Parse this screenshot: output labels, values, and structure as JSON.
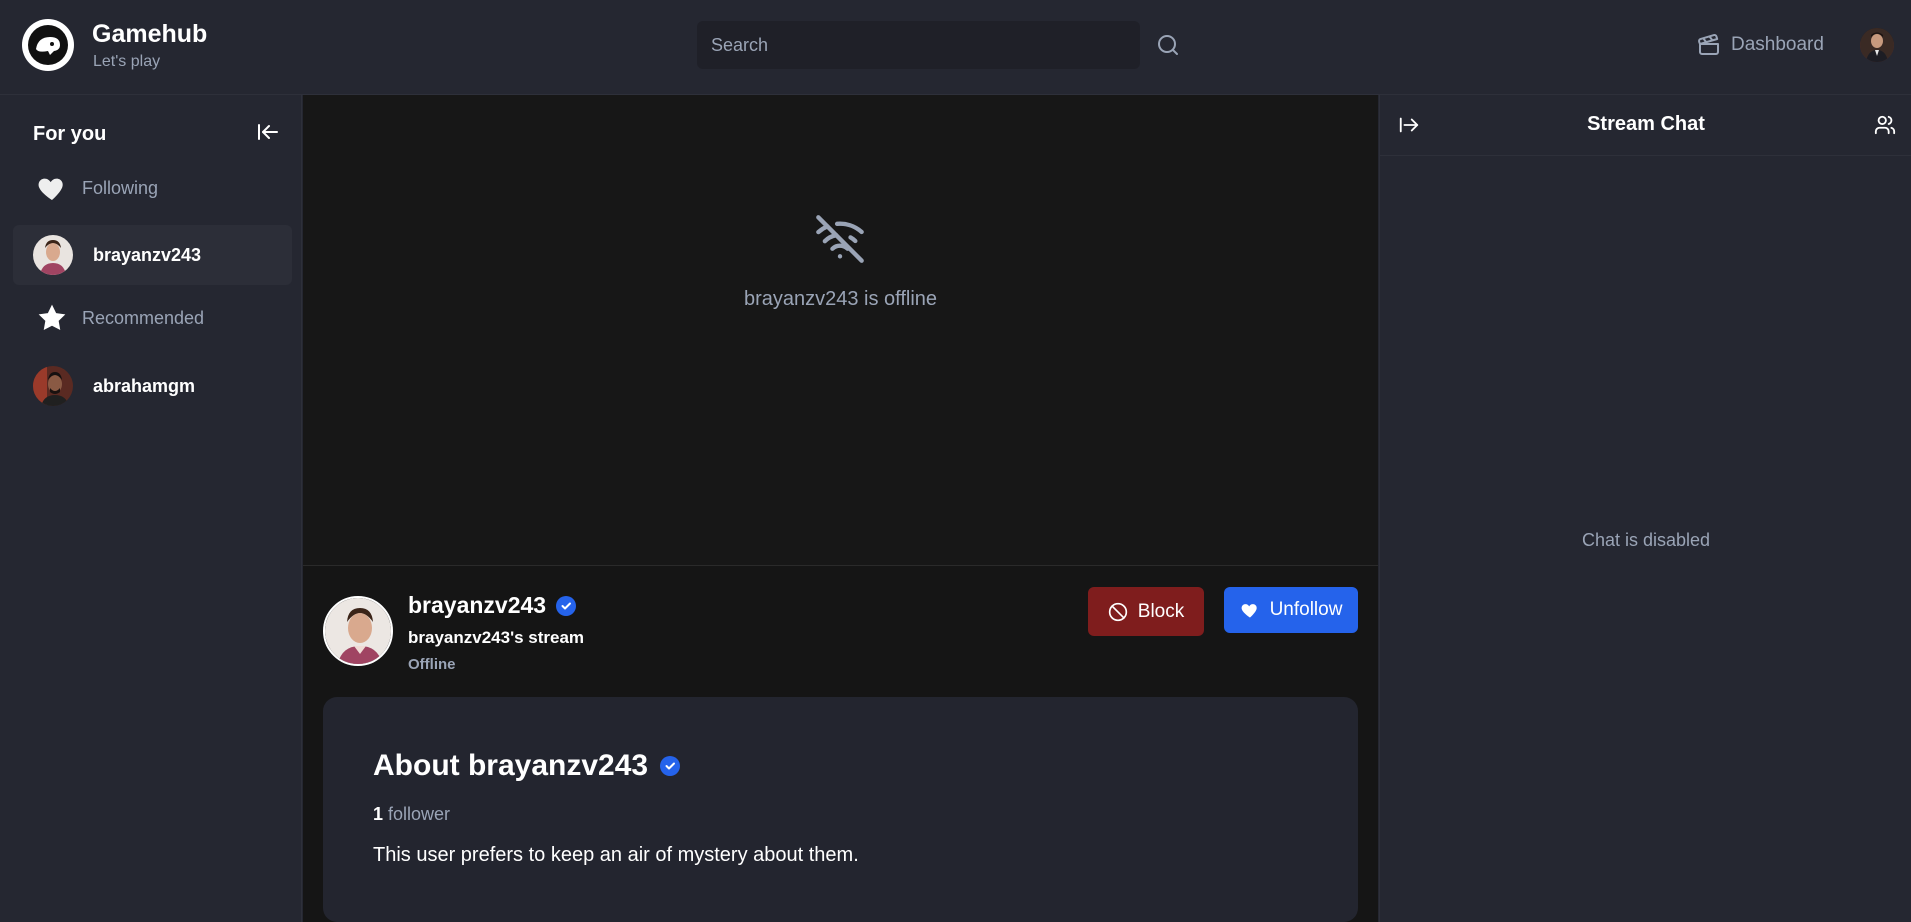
{
  "brand": {
    "name": "Gamehub",
    "tagline": "Let's play"
  },
  "search": {
    "placeholder": "Search"
  },
  "header": {
    "dashboard_label": "Dashboard"
  },
  "sidebar": {
    "title": "For you",
    "following_label": "Following",
    "following": [
      {
        "username": "brayanzv243",
        "active": true
      }
    ],
    "recommended_label": "Recommended",
    "recommended": [
      {
        "username": "abrahamgm",
        "active": false
      }
    ]
  },
  "player": {
    "offline_message": "brayanzv243 is offline"
  },
  "stream_info": {
    "username": "brayanzv243",
    "stream_name": "brayanzv243's stream",
    "status": "Offline",
    "block_label": "Block",
    "unfollow_label": "Unfollow"
  },
  "about": {
    "title": "About brayanzv243",
    "follower_count": "1",
    "follower_label": "follower",
    "bio": "This user prefers to keep an air of mystery about them."
  },
  "chat": {
    "title": "Stream Chat",
    "disabled_message": "Chat is disabled"
  },
  "colors": {
    "background": "#252731",
    "player_bg": "#171717",
    "accent_blue": "#2563eb",
    "block_red": "#7f1d1d",
    "muted_text": "#9aa4b6"
  },
  "icons": [
    "logo-mascot",
    "search-icon",
    "clapperboard-icon",
    "arrow-left-to-line-icon",
    "heart-icon",
    "star-icon",
    "wifi-off-icon",
    "verified-icon",
    "ban-icon",
    "arrow-right-to-line-icon",
    "users-icon"
  ]
}
